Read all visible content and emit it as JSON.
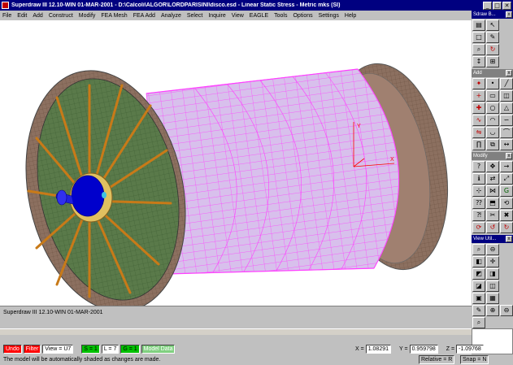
{
  "window": {
    "title": "Superdraw III 12.10-WIN 01-MAR-2001  -  D:\\Calcoli\\ALGOR\\LORDPARISINI\\disco.esd  -  Linear Static Stress  -  Metric mks (SI)",
    "controls": [
      "_",
      "□",
      "✕"
    ]
  },
  "menu": {
    "items": [
      "File",
      "Edit",
      "Add",
      "Construct",
      "Modify",
      "FEA Mesh",
      "FEA Add",
      "Analyze",
      "Select",
      "Inquire",
      "View",
      "EAGLE",
      "Tools",
      "Options",
      "Settings",
      "Help"
    ]
  },
  "palettes": {
    "basic": "Sdraw B...",
    "add": "Add",
    "modify": "Modify",
    "view": "View Util..."
  },
  "command": {
    "line": "Superdraw III 12.10-WIN 01-MAR-2001"
  },
  "status": {
    "undo": "Undo",
    "filter": "Filter",
    "view": "View = U7",
    "s": "S = 1",
    "l": "L = 7",
    "g": "G = 1",
    "model_data": "Model Data",
    "x_label": "X =",
    "x_value": "1.08291",
    "y_label": "Y =",
    "y_value": "0.959798",
    "z_label": "Z =",
    "z_value": "-1.09768",
    "hint": "The model will be automatically shaded as changes are made.",
    "relative": "Relative = R",
    "snap": "Snap = N"
  },
  "colors": {
    "titlebar": "#000080",
    "mesh_magenta": "#ff40ff",
    "drum_lavender": "#d8c0ec",
    "flange_brown": "#8c7060",
    "disc_green": "#5a7a4a",
    "rib_orange": "#c87a18",
    "hub_blue": "#0000cc",
    "axis_red": "#ff0000"
  }
}
